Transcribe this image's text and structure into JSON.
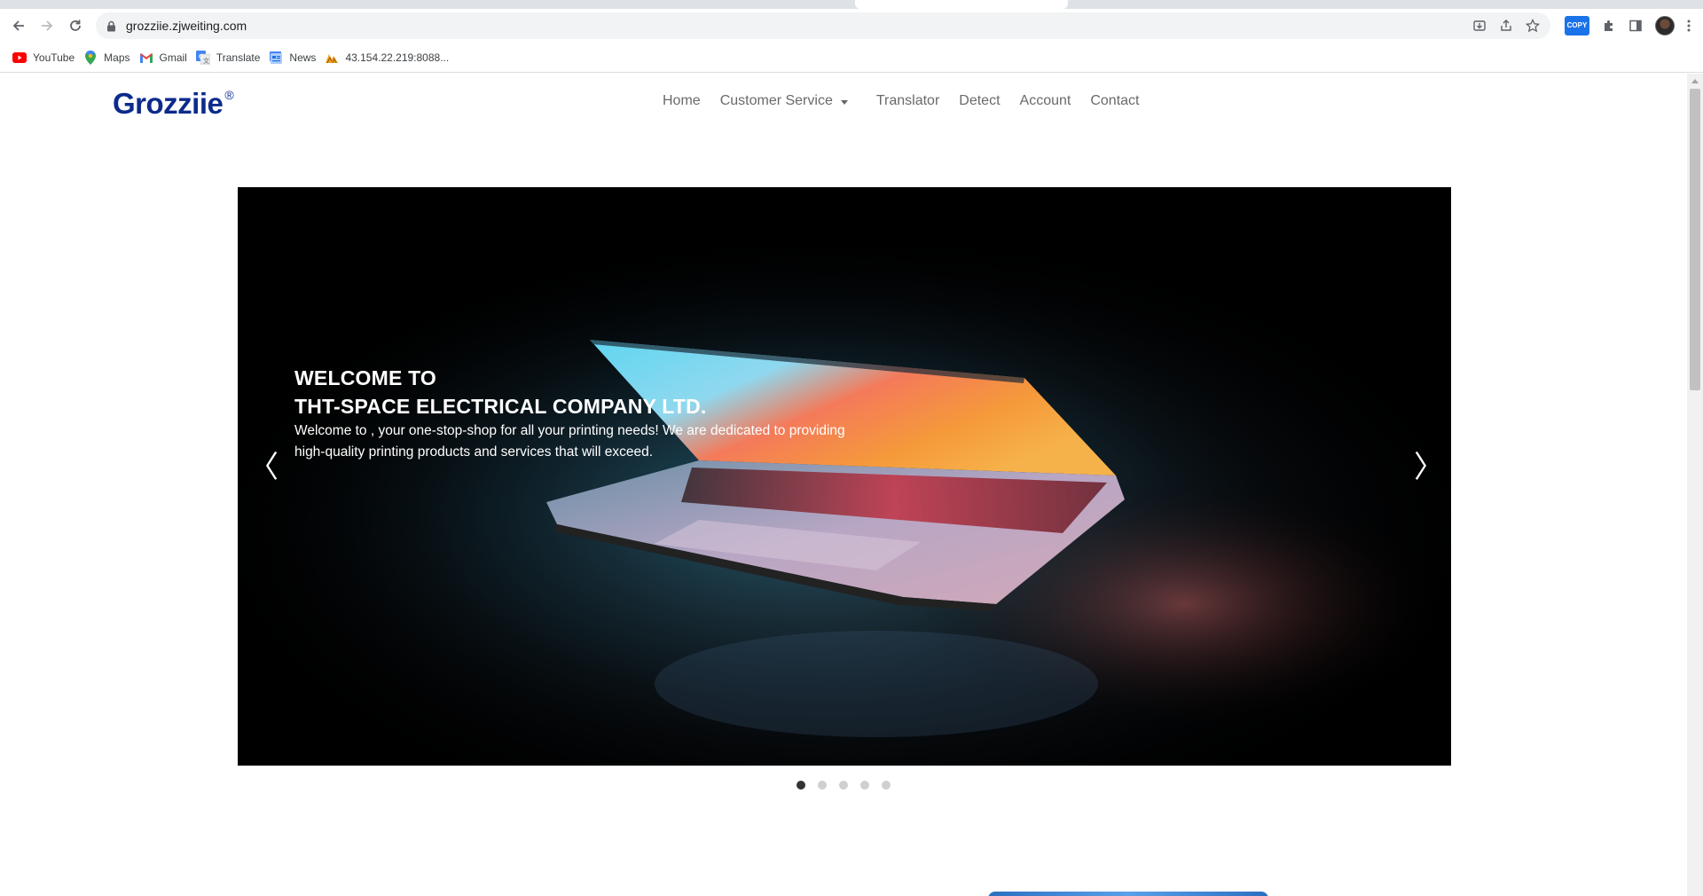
{
  "browser": {
    "url": "grozziie.zjweiting.com",
    "bookmarks": [
      {
        "label": "YouTube",
        "icon": "youtube-icon"
      },
      {
        "label": "Maps",
        "icon": "maps-icon"
      },
      {
        "label": "Gmail",
        "icon": "gmail-icon"
      },
      {
        "label": "Translate",
        "icon": "translate-icon"
      },
      {
        "label": "News",
        "icon": "news-icon"
      },
      {
        "label": "43.154.22.219:8088...",
        "icon": "site-icon"
      }
    ],
    "extension_label": "COPY"
  },
  "site": {
    "logo": "Grozziie",
    "logo_mark": "®",
    "nav": {
      "home": "Home",
      "customer_service": "Customer Service",
      "translator": "Translator",
      "detect": "Detect",
      "account": "Account",
      "contact": "Contact"
    }
  },
  "hero": {
    "line1": "WELCOME TO",
    "line2": "THT-SPACE ELECTRICAL COMPANY LTD.",
    "text": "Welcome to , your one-stop-shop for all your printing needs! We are dedicated to providing high-quality printing products and services that will exceed.",
    "prev_symbol": "〈",
    "next_symbol": "〉",
    "slide_count": 5,
    "active_slide": 1
  },
  "colors": {
    "logo": "#0d2b8c",
    "nav_text": "#6a6a6a",
    "hero_bg": "#000000",
    "dot_active": "#333333",
    "dot_inactive": "#cfcfcf"
  }
}
